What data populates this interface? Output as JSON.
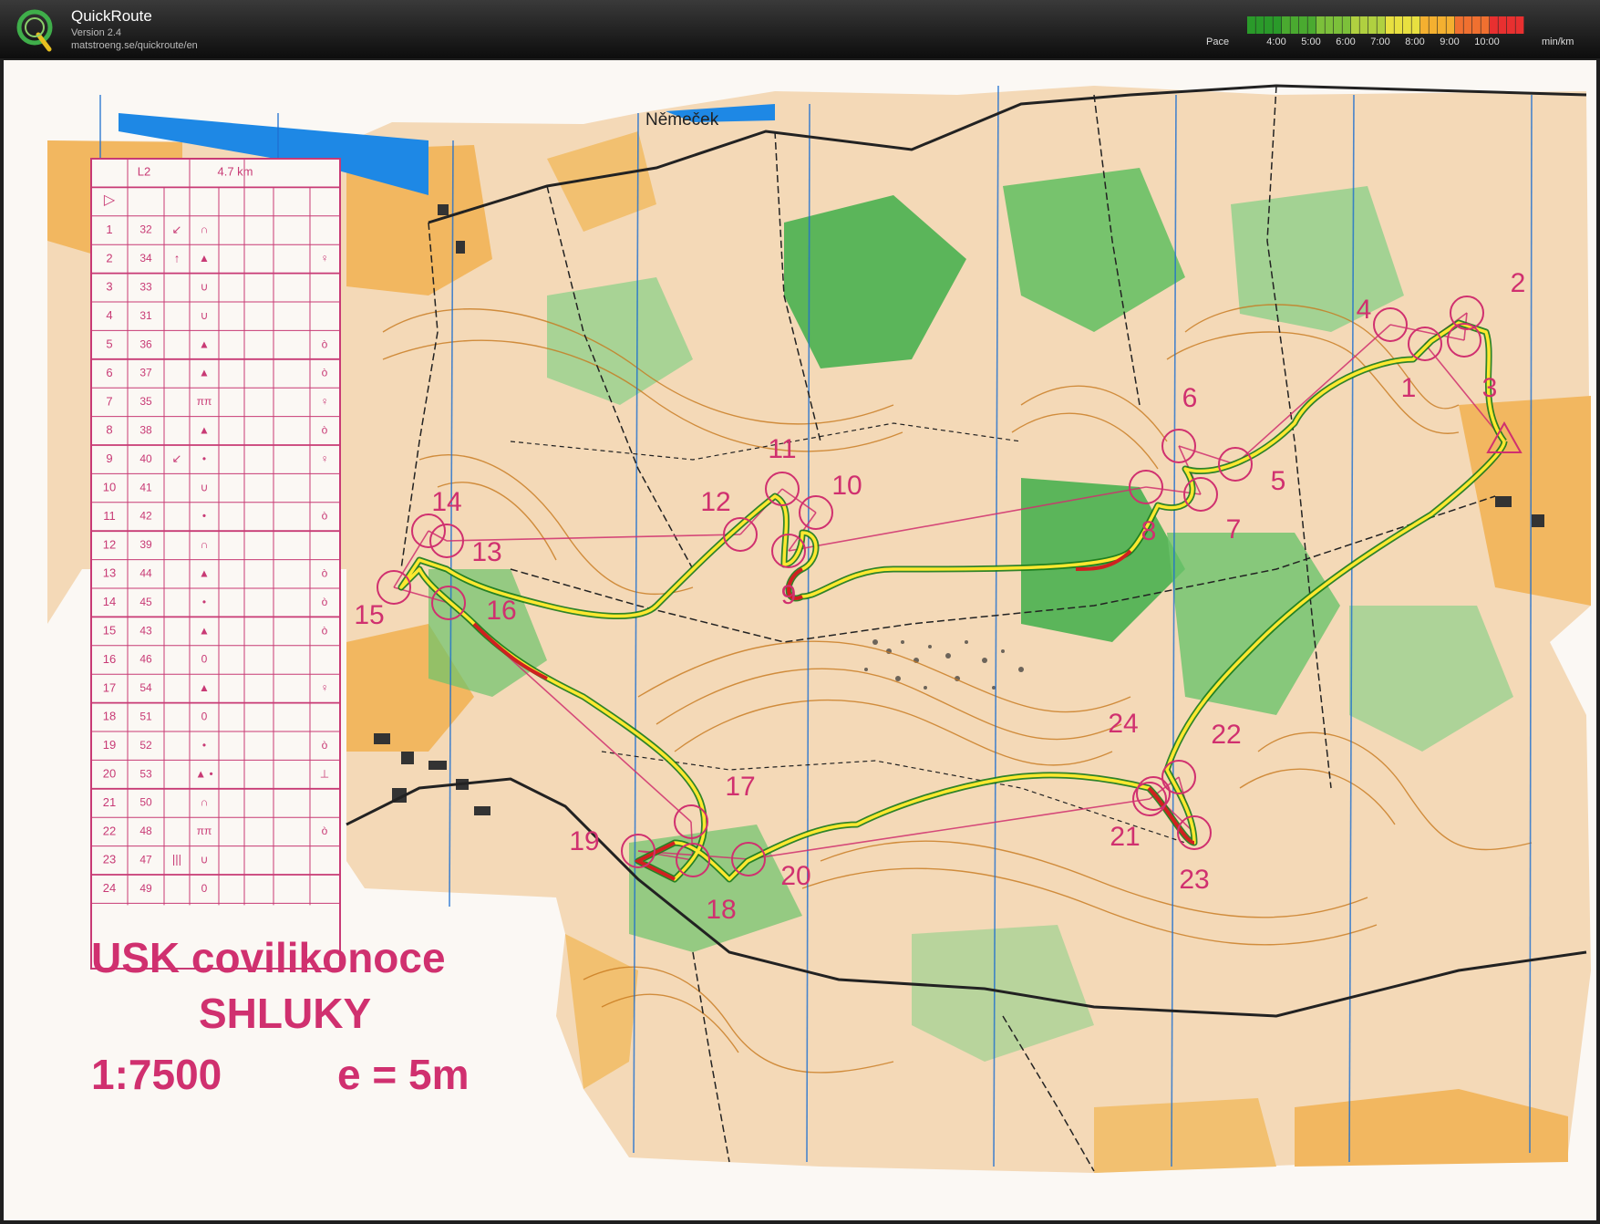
{
  "app": {
    "name": "QuickRoute",
    "version": "Version 2.4",
    "url": "matstroeng.se/quickroute/en",
    "logo_letter": "Q"
  },
  "pace_scale": {
    "label": "Pace",
    "ticks": [
      "4:00",
      "5:00",
      "6:00",
      "7:00",
      "8:00",
      "9:00",
      "10:00"
    ],
    "unit": "min/km",
    "colors": [
      "#2a9a2a",
      "#4aaa30",
      "#7cc03a",
      "#b0d040",
      "#e8e040",
      "#f4b030",
      "#f07030",
      "#e83030"
    ]
  },
  "map": {
    "place_label": "Němeček",
    "title_line1": "USK covilikonoce",
    "title_line2": "SHLUKY",
    "scale": "1:7500",
    "contour": "e = 5m",
    "colors": {
      "route": "#ffe830",
      "route_fast": "#1a7a1a",
      "route_slow": "#d02020",
      "course": "#d0306f",
      "open": "#f2b760",
      "forest_green": "#3fae4a",
      "water": "#1e88e5",
      "paper": "#fbf8f4"
    },
    "controls": [
      {
        "n": "1"
      },
      {
        "n": "2"
      },
      {
        "n": "3"
      },
      {
        "n": "4"
      },
      {
        "n": "5"
      },
      {
        "n": "6"
      },
      {
        "n": "7"
      },
      {
        "n": "8"
      },
      {
        "n": "9"
      },
      {
        "n": "10"
      },
      {
        "n": "11"
      },
      {
        "n": "12"
      },
      {
        "n": "13"
      },
      {
        "n": "14"
      },
      {
        "n": "15"
      },
      {
        "n": "16"
      },
      {
        "n": "17"
      },
      {
        "n": "18"
      },
      {
        "n": "19"
      },
      {
        "n": "20"
      },
      {
        "n": "21"
      },
      {
        "n": "22"
      },
      {
        "n": "23"
      },
      {
        "n": "24"
      }
    ]
  },
  "description_sheet": {
    "class": "L2",
    "length": "4.7 km",
    "start_symbol": "▷",
    "rows": [
      {
        "n": "1",
        "code": "32",
        "dir": "↙",
        "feature": "∩",
        "detail": ""
      },
      {
        "n": "2",
        "code": "34",
        "dir": "↑",
        "feature": "▲",
        "detail": "♀"
      },
      {
        "n": "3",
        "code": "33",
        "dir": "",
        "feature": "∪",
        "detail": ""
      },
      {
        "n": "4",
        "code": "31",
        "dir": "",
        "feature": "∪",
        "detail": ""
      },
      {
        "n": "5",
        "code": "36",
        "dir": "",
        "feature": "▲",
        "detail": "ò"
      },
      {
        "n": "6",
        "code": "37",
        "dir": "",
        "feature": "▲",
        "detail": "ò"
      },
      {
        "n": "7",
        "code": "35",
        "dir": "",
        "feature": "ππ",
        "detail": "♀"
      },
      {
        "n": "8",
        "code": "38",
        "dir": "",
        "feature": "▲",
        "detail": "ò"
      },
      {
        "n": "9",
        "code": "40",
        "dir": "↙",
        "feature": "•",
        "detail": "♀"
      },
      {
        "n": "10",
        "code": "41",
        "dir": "",
        "feature": "∪",
        "detail": ""
      },
      {
        "n": "11",
        "code": "42",
        "dir": "",
        "feature": "•",
        "detail": "ò"
      },
      {
        "n": "12",
        "code": "39",
        "dir": "",
        "feature": "∩",
        "detail": ""
      },
      {
        "n": "13",
        "code": "44",
        "dir": "",
        "feature": "▲",
        "detail": "ò"
      },
      {
        "n": "14",
        "code": "45",
        "dir": "",
        "feature": "•",
        "detail": "ò"
      },
      {
        "n": "15",
        "code": "43",
        "dir": "",
        "feature": "▲",
        "detail": "ò"
      },
      {
        "n": "16",
        "code": "46",
        "dir": "",
        "feature": "0",
        "detail": ""
      },
      {
        "n": "17",
        "code": "54",
        "dir": "",
        "feature": "▲",
        "detail": "♀"
      },
      {
        "n": "18",
        "code": "51",
        "dir": "",
        "feature": "0",
        "detail": ""
      },
      {
        "n": "19",
        "code": "52",
        "dir": "",
        "feature": "•",
        "detail": "ò"
      },
      {
        "n": "20",
        "code": "53",
        "dir": "",
        "feature": "▲  •",
        "detail": "⊥"
      },
      {
        "n": "21",
        "code": "50",
        "dir": "",
        "feature": "∩",
        "detail": ""
      },
      {
        "n": "22",
        "code": "48",
        "dir": "",
        "feature": "ππ",
        "detail": "ò"
      },
      {
        "n": "23",
        "code": "47",
        "dir": "|||",
        "feature": "∪",
        "detail": ""
      },
      {
        "n": "24",
        "code": "49",
        "dir": "",
        "feature": "0",
        "detail": ""
      }
    ]
  }
}
